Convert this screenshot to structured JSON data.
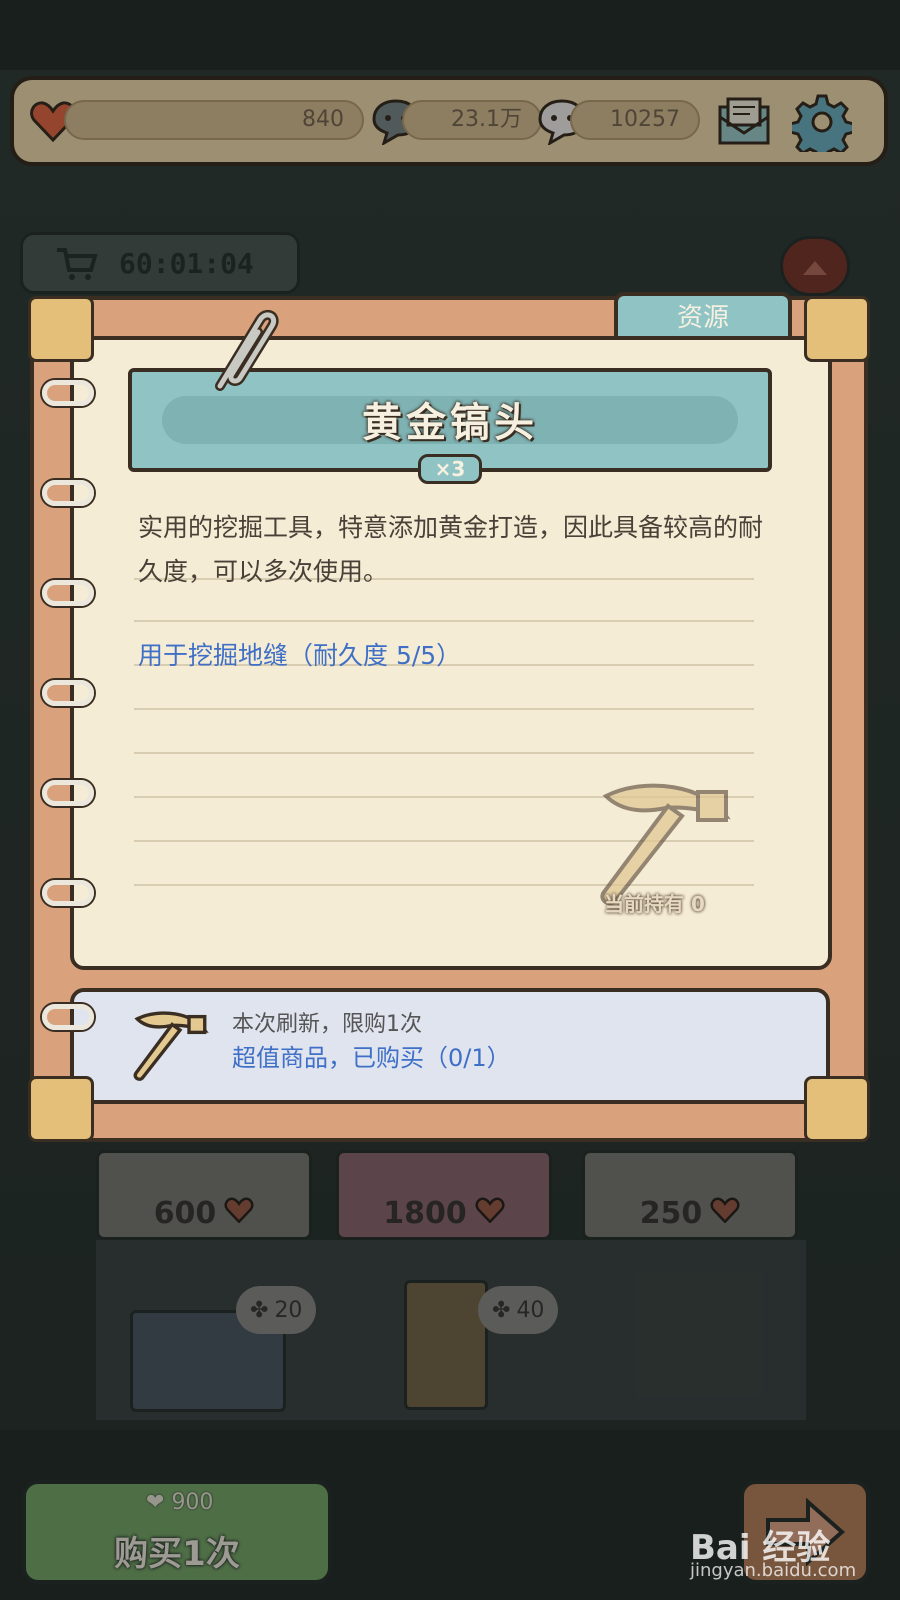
{
  "topbar": {
    "hearts": "840",
    "gray_bubbles": "23.1万",
    "white_bubbles": "10257",
    "icons": [
      "heart-icon",
      "gray-speech-bubble-icon",
      "white-speech-bubble-icon",
      "mail-icon",
      "gear-icon"
    ]
  },
  "shop": {
    "timer": "60:01:04",
    "shelf_prices": [
      "600",
      "1800",
      "250"
    ],
    "bubble_costs": [
      "20",
      "40"
    ],
    "buy_button_label": "购买1次",
    "buy_button_cost": "900"
  },
  "notebook": {
    "tab_label": "资源",
    "item_title": "黄金镐头",
    "quantity": "×3",
    "description": "实用的挖掘工具，特意添加黄金打造，因此具备较高的耐久度，可以多次使用。",
    "usage": "用于挖掘地缝（耐久度  5/5）",
    "holding_label": "当前持有  0",
    "purchase_limit": "本次刷新，限购1次",
    "purchase_status": "超值商品，已购买（0/1）"
  },
  "watermark": {
    "brand": "Bai 经验",
    "url": "jingyan.baidu.com"
  },
  "colors": {
    "accent_teal": "#8fc3c4",
    "paper": "#f5ecd5",
    "link_blue": "#3f6fc6",
    "buy_green": "#79a96c"
  }
}
